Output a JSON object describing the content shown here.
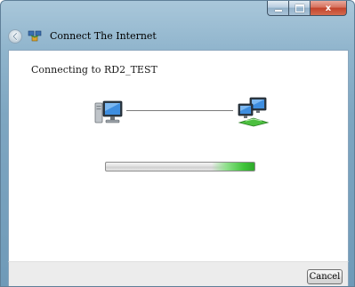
{
  "window": {
    "title": "Connect The Internet",
    "close_glyph": "x"
  },
  "content": {
    "status_text": "Connecting to RD2_TEST"
  },
  "icons": {
    "back": "back-arrow-icon",
    "app": "network-connect-icon",
    "local_computer": "computer-icon",
    "network": "network-computers-icon"
  },
  "progress": {
    "state": "indeterminate"
  },
  "footer": {
    "cancel_label": "Cancel"
  },
  "colors": {
    "progress_accent": "#3fc43a",
    "close_button": "#c2432b"
  }
}
